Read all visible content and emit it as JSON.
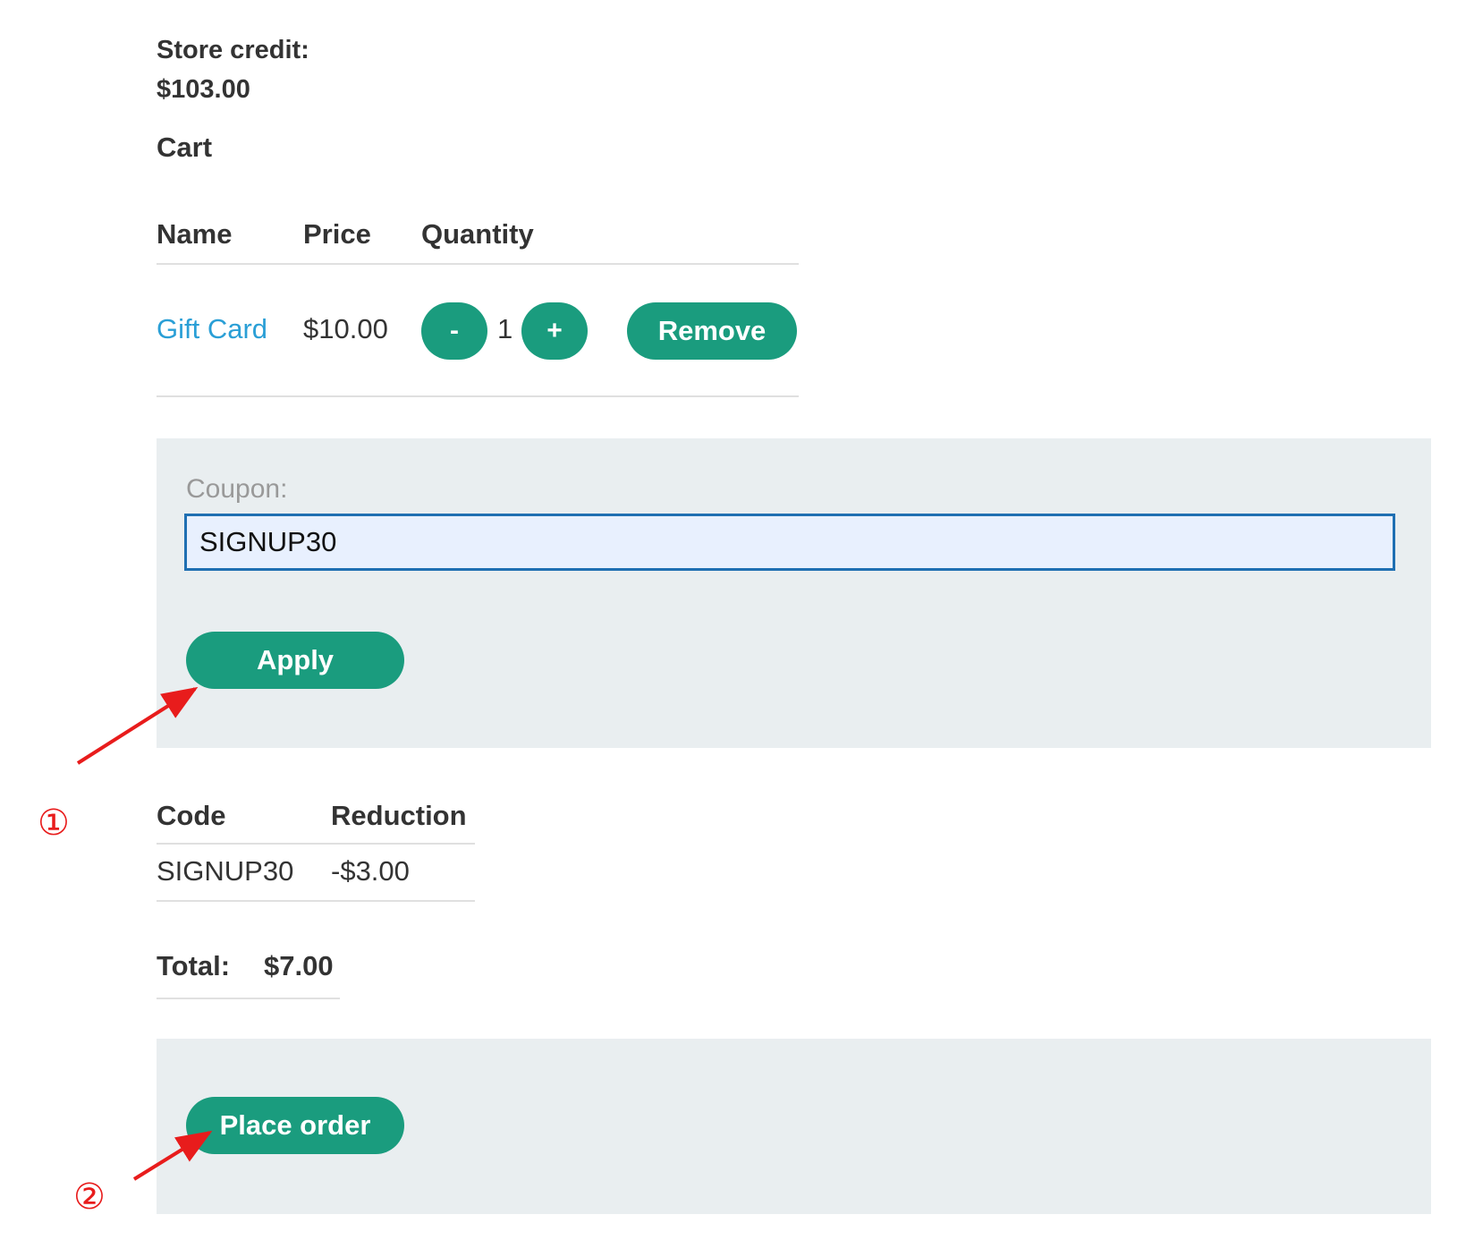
{
  "store_credit": {
    "label": "Store credit:",
    "value": "$103.00"
  },
  "cart": {
    "title": "Cart",
    "headers": {
      "name": "Name",
      "price": "Price",
      "quantity": "Quantity"
    },
    "items": [
      {
        "name": "Gift Card",
        "price": "$10.00",
        "quantity": "1",
        "decrement_label": "-",
        "increment_label": "+",
        "remove_label": "Remove"
      }
    ]
  },
  "coupon_form": {
    "label": "Coupon:",
    "value": "SIGNUP30",
    "apply_label": "Apply"
  },
  "coupons_applied": {
    "headers": {
      "code": "Code",
      "reduction": "Reduction"
    },
    "rows": [
      {
        "code": "SIGNUP30",
        "reduction": "-$3.00"
      }
    ]
  },
  "total": {
    "label": "Total:",
    "value": "$7.00"
  },
  "order": {
    "place_order_label": "Place order"
  },
  "annotations": {
    "marker_1": "①",
    "marker_2": "②",
    "color": "#e81c1c"
  },
  "colors": {
    "accent": "#1a9c7e",
    "link": "#2a9fd6",
    "panel_bg": "#e9eef0",
    "input_border": "#1f6fb2",
    "input_bg": "#e8f0fe"
  }
}
